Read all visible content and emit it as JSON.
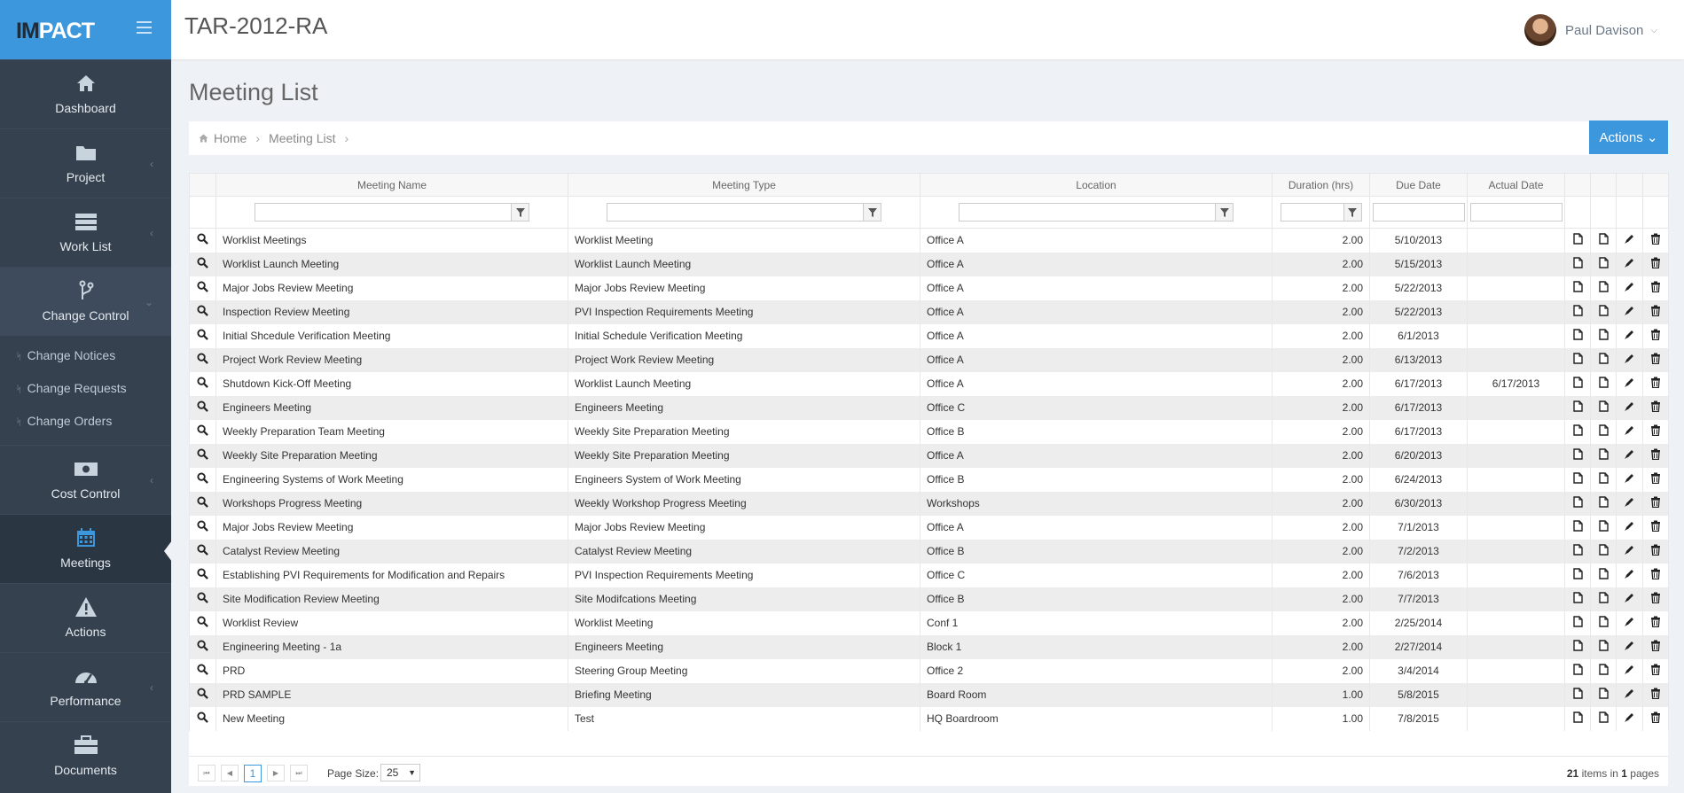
{
  "brand": {
    "logo_prefix": "IM",
    "logo_suffix": "PACT"
  },
  "header": {
    "project": "TAR-2012-RA",
    "user_name": "Paul Davison"
  },
  "sidebar": {
    "items": [
      {
        "label": "Dashboard",
        "icon": "home-icon"
      },
      {
        "label": "Project",
        "icon": "folder-icon"
      },
      {
        "label": "Work List",
        "icon": "list-icon"
      },
      {
        "label": "Change Control",
        "icon": "branch-icon"
      },
      {
        "label": "Cost Control",
        "icon": "money-icon"
      },
      {
        "label": "Meetings",
        "icon": "calendar-icon"
      },
      {
        "label": "Actions",
        "icon": "warning-icon"
      },
      {
        "label": "Performance",
        "icon": "dashboard-icon"
      },
      {
        "label": "Documents",
        "icon": "briefcase-icon"
      }
    ],
    "sub_items": [
      "Change Notices",
      "Change Requests",
      "Change Orders"
    ]
  },
  "page": {
    "title": "Meeting List",
    "breadcrumb_home": "Home",
    "breadcrumb_current": "Meeting List",
    "actions_label": "Actions"
  },
  "grid": {
    "columns": [
      "Meeting Name",
      "Meeting Type",
      "Location",
      "Duration (hrs)",
      "Due Date",
      "Actual Date"
    ],
    "rows": [
      [
        "Worklist Meetings",
        "Worklist Meeting",
        "Office A",
        "2.00",
        "5/10/2013",
        ""
      ],
      [
        "Worklist Launch Meeting",
        "Worklist Launch Meeting",
        "Office A",
        "2.00",
        "5/15/2013",
        ""
      ],
      [
        "Major Jobs Review Meeting",
        "Major Jobs Review Meeting",
        "Office A",
        "2.00",
        "5/22/2013",
        ""
      ],
      [
        "Inspection Review Meeting",
        "PVI Inspection Requirements Meeting",
        "Office A",
        "2.00",
        "5/22/2013",
        ""
      ],
      [
        "Initial Shcedule Verification Meeting",
        "Initial Schedule Verification Meeting",
        "Office A",
        "2.00",
        "6/1/2013",
        ""
      ],
      [
        "Project Work Review Meeting",
        "Project Work Review Meeting",
        "Office A",
        "2.00",
        "6/13/2013",
        ""
      ],
      [
        "Shutdown Kick-Off Meeting",
        "Worklist Launch Meeting",
        "Office A",
        "2.00",
        "6/17/2013",
        "6/17/2013"
      ],
      [
        "Engineers Meeting",
        "Engineers Meeting",
        "Office C",
        "2.00",
        "6/17/2013",
        ""
      ],
      [
        "Weekly Preparation Team Meeting",
        "Weekly Site Preparation Meeting",
        "Office B",
        "2.00",
        "6/17/2013",
        ""
      ],
      [
        "Weekly Site Preparation Meeting",
        "Weekly Site Preparation Meeting",
        "Office A",
        "2.00",
        "6/20/2013",
        ""
      ],
      [
        "Engineering Systems of Work Meeting",
        "Engineers System of Work Meeting",
        "Office B",
        "2.00",
        "6/24/2013",
        ""
      ],
      [
        "Workshops Progress Meeting",
        "Weekly Workshop Progress Meeting",
        "Workshops",
        "2.00",
        "6/30/2013",
        ""
      ],
      [
        "Major Jobs Review Meeting",
        "Major Jobs Review Meeting",
        "Office A",
        "2.00",
        "7/1/2013",
        ""
      ],
      [
        "Catalyst Review Meeting",
        "Catalyst Review Meeting",
        "Office B",
        "2.00",
        "7/2/2013",
        ""
      ],
      [
        "Establishing PVI Requirements for Modification and Repairs",
        "PVI Inspection Requirements Meeting",
        "Office C",
        "2.00",
        "7/6/2013",
        ""
      ],
      [
        "Site Modification Review Meeting",
        "Site Modifcations Meeting",
        "Office B",
        "2.00",
        "7/7/2013",
        ""
      ],
      [
        "Worklist Review",
        "Worklist Meeting",
        "Conf 1",
        "2.00",
        "2/25/2014",
        ""
      ],
      [
        "Engineering Meeting - 1a",
        "Engineers Meeting",
        "Block 1",
        "2.00",
        "2/27/2014",
        ""
      ],
      [
        "PRD",
        "Steering Group Meeting",
        "Office 2",
        "2.00",
        "3/4/2014",
        ""
      ],
      [
        "PRD SAMPLE",
        "Briefing Meeting",
        "Board Room",
        "1.00",
        "5/8/2015",
        ""
      ],
      [
        "New Meeting",
        "Test",
        "HQ Boardroom",
        "1.00",
        "7/8/2015",
        ""
      ]
    ]
  },
  "pager": {
    "current_page": "1",
    "page_size_label": "Page Size:",
    "page_size": "25",
    "items_count": "21",
    "items_text": "items in",
    "pages_count": "1",
    "pages_text": "pages"
  }
}
